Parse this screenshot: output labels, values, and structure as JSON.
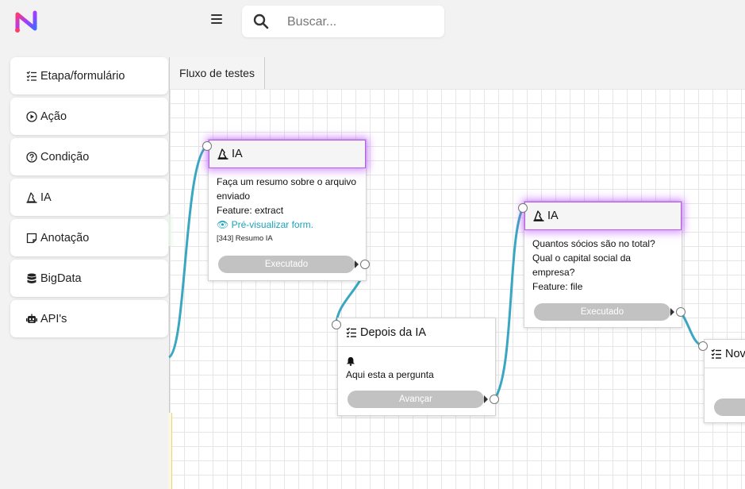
{
  "app": {
    "logo_icon": "n-logo-icon"
  },
  "search": {
    "placeholder": "Buscar..."
  },
  "sidebar": {
    "items": [
      {
        "label": "Etapa/formulário",
        "icon": "checklist-icon"
      },
      {
        "label": "Ação",
        "icon": "play-circle-icon"
      },
      {
        "label": "Condição",
        "icon": "question-circle-icon"
      },
      {
        "label": "IA",
        "icon": "wizard-hat-icon"
      },
      {
        "label": "Anotação",
        "icon": "note-icon"
      },
      {
        "label": "BigData",
        "icon": "database-icon"
      },
      {
        "label": "API's",
        "icon": "robot-icon"
      }
    ]
  },
  "tabs": [
    {
      "label": "Fluxo de testes"
    }
  ],
  "nodes": [
    {
      "title": "IA",
      "icon": "wizard-hat-icon",
      "lines": [
        "Faça um resumo sobre o arquivo enviado",
        "Feature: extract"
      ],
      "preview_label": "Pré-visualizar form.",
      "ref": "[343] Resumo IA",
      "button": "Executado"
    },
    {
      "title": "Depois da IA",
      "icon": "checklist-icon",
      "lines": [
        "Aqui esta a pergunta"
      ],
      "button": "Avançar"
    },
    {
      "title": "IA",
      "icon": "wizard-hat-icon",
      "lines": [
        "Quantos sócios são no total? Qual o capital social da empresa?",
        "Feature: file"
      ],
      "button": "Executado"
    },
    {
      "title": "Nov",
      "icon": "checklist-icon"
    }
  ],
  "colors": {
    "wire": "#3aa7c2",
    "glow": "#b45cf0",
    "link": "#1ba3b8",
    "button_gray": "#c2c2c2"
  }
}
